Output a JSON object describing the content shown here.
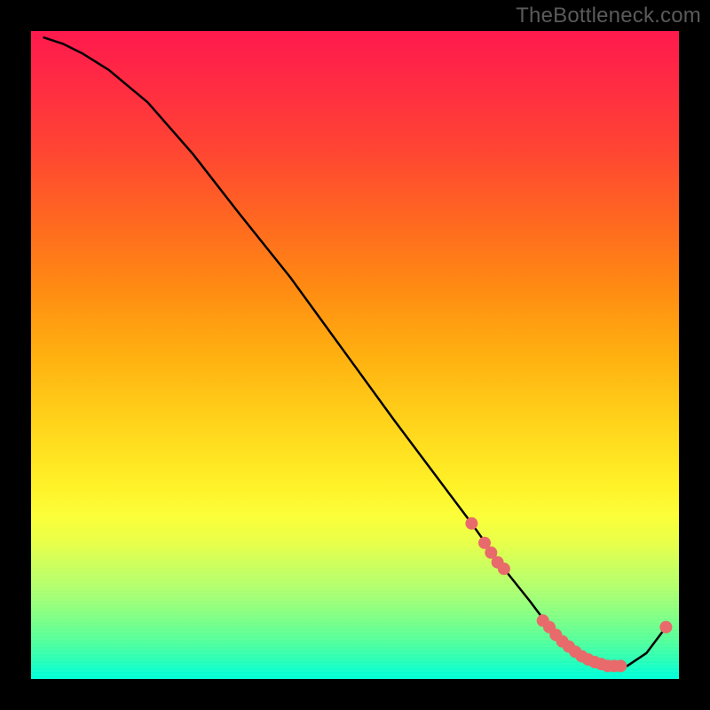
{
  "watermark": "TheBottleneck.com",
  "chart_data": {
    "type": "line",
    "title": "",
    "xlabel": "",
    "ylabel": "",
    "xlim": [
      0,
      100
    ],
    "ylim": [
      0,
      100
    ],
    "curve": {
      "name": "bottleneck-curve",
      "x": [
        2,
        5,
        8,
        12,
        18,
        25,
        32,
        40,
        48,
        56,
        62,
        68,
        73,
        77,
        80,
        83,
        86,
        89,
        92,
        95,
        98
      ],
      "y": [
        99,
        98,
        96.5,
        94,
        89,
        81,
        72,
        62,
        51,
        40,
        32,
        24,
        17,
        12,
        8,
        5,
        3,
        2,
        2,
        4,
        8
      ]
    },
    "marker_series": {
      "name": "highlighted-points",
      "color": "#e86a6a",
      "points": [
        {
          "x": 68,
          "y": 24
        },
        {
          "x": 70,
          "y": 21
        },
        {
          "x": 71,
          "y": 19.5
        },
        {
          "x": 72,
          "y": 18
        },
        {
          "x": 73,
          "y": 17
        },
        {
          "x": 79,
          "y": 9
        },
        {
          "x": 80,
          "y": 8
        },
        {
          "x": 81,
          "y": 6.8
        },
        {
          "x": 82,
          "y": 5.8
        },
        {
          "x": 83,
          "y": 5
        },
        {
          "x": 84,
          "y": 4.2
        },
        {
          "x": 85,
          "y": 3.5
        },
        {
          "x": 86,
          "y": 3
        },
        {
          "x": 87,
          "y": 2.6
        },
        {
          "x": 88,
          "y": 2.3
        },
        {
          "x": 89,
          "y": 2
        },
        {
          "x": 90,
          "y": 2
        },
        {
          "x": 91,
          "y": 2
        },
        {
          "x": 98,
          "y": 8
        }
      ]
    },
    "annotation": {
      "text": "",
      "x": 85,
      "y": 3
    }
  }
}
